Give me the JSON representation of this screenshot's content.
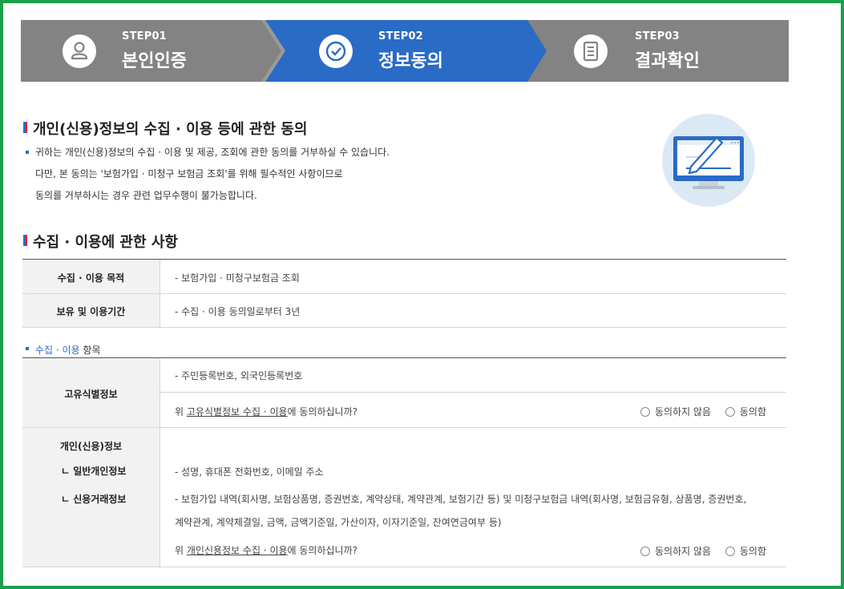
{
  "steps": [
    {
      "num": "STEP01",
      "name": "본인인증",
      "icon": "user-icon",
      "active": false
    },
    {
      "num": "STEP02",
      "name": "정보동의",
      "icon": "check-circle-icon",
      "active": true
    },
    {
      "num": "STEP03",
      "name": "결과확인",
      "icon": "document-icon",
      "active": false
    }
  ],
  "colors": {
    "active_step": "#2a6bc6",
    "inactive_step": "#838383",
    "accent_blue": "#2a6bc6",
    "accent_red": "#d92b2b",
    "frame": "#1aa14a"
  },
  "consent": {
    "title": "개인(신용)정보의 수집 · 이용 등에 관한 동의",
    "lines": [
      "귀하는 개인(신용)정보의 수집 · 이용 및 제공, 조회에 관한 동의를 거부하실 수 있습니다.",
      "다만, 본 동의는 '보험가입 · 미청구 보험금 조회'를 위해 필수적인 사항이므로",
      "동의를 거부하시는 경우 관련 업무수행이 불가능합니다."
    ],
    "illustration": "computer-monitor-pen-icon"
  },
  "collection": {
    "title": "수집 · 이용에 관한 사항",
    "purpose_label": "수집 · 이용 목적",
    "purpose_value": "- 보험가입 · 미청구보험금 조회",
    "period_label": "보유 및 이용기간",
    "period_value": "- 수집 · 이용 동의일로부터 3년",
    "items_heading_blue": "수집 · 이용",
    "items_heading_rest": " 항목",
    "unique": {
      "label": "고유식별정보",
      "value": "- 주민등록번호, 외국인등록번호",
      "question_pre": "위 ",
      "question_link": "고유식별정보 수집 · 이용",
      "question_post": "에 동의하십니까?",
      "disagree": "동의하지 않음",
      "agree": "동의함"
    },
    "personal": {
      "label": "개인(신용)정보",
      "general_label": "ㄴ 일반개인정보",
      "general_value": "- 성명, 휴대폰 전화번호, 이메일 주소",
      "credit_label": "ㄴ 신용거래정보",
      "credit_value_1": "- 보험가입 내역(회사명, 보험상품명, 증권번호, 계약상태, 계약관계, 보험기간 등) 및 미청구보험금 내역(회사명, 보험금유형, 상품명, 증권번호,",
      "credit_value_2": "계약관계, 계약체결일, 금액, 금액기준일, 가산이자, 이자기준일, 잔여연금여부 등)",
      "question_pre": "위 ",
      "question_link": "개인신용정보 수집 · 이용",
      "question_post": "에 동의하십니까?",
      "disagree": "동의하지 않음",
      "agree": "동의함"
    }
  }
}
